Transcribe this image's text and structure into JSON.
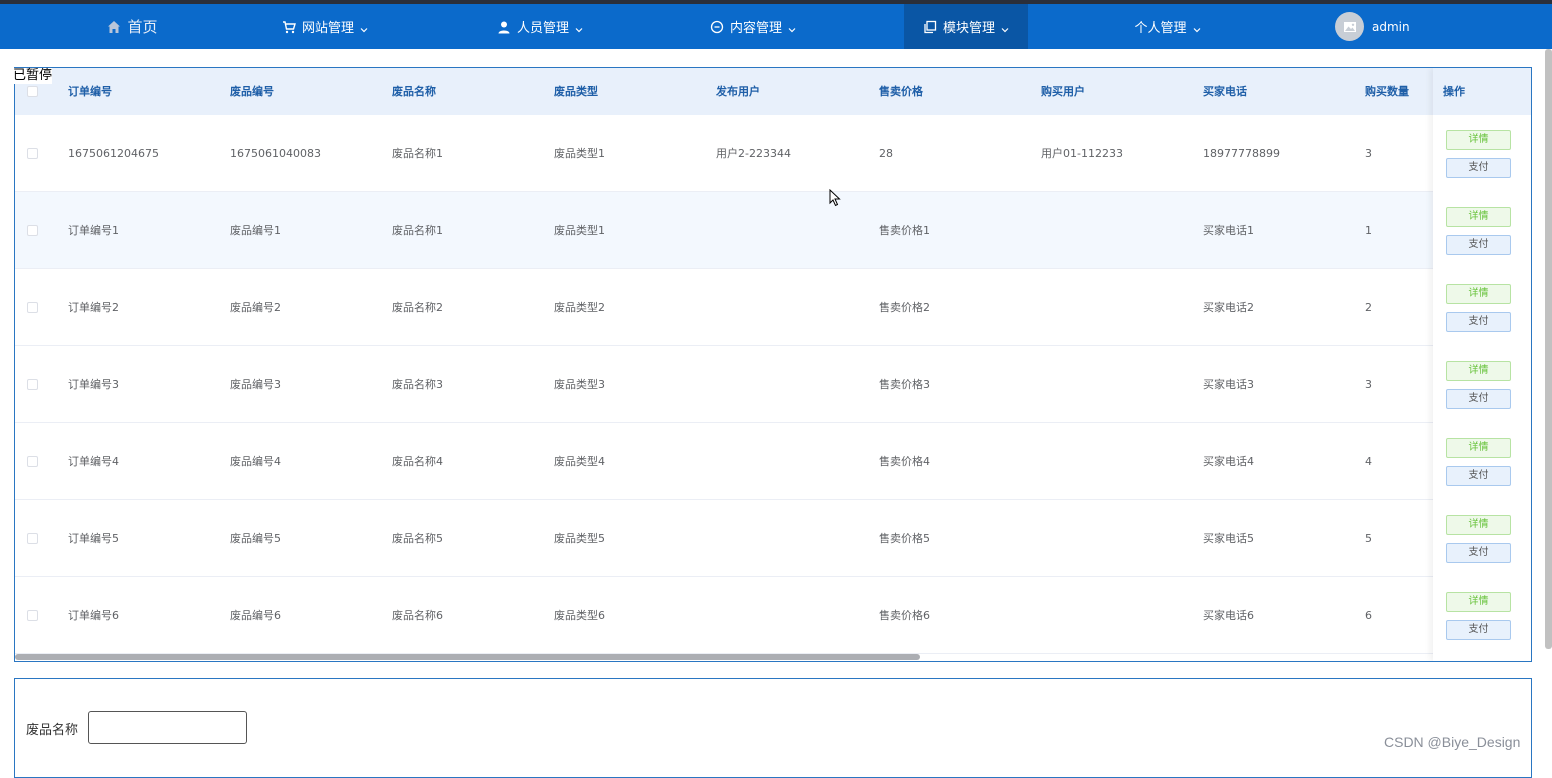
{
  "nav": {
    "home": "首页",
    "site_manage": "网站管理",
    "people_manage": "人员管理",
    "content_manage": "内容管理",
    "module_manage": "模块管理",
    "personal_manage": "个人管理",
    "user": "admin"
  },
  "overlay": {
    "paused": "已暂停"
  },
  "table": {
    "headers": {
      "order_no": "订单编号",
      "item_no": "废品编号",
      "item_name": "废品名称",
      "item_type": "废品类型",
      "publisher": "发布用户",
      "price": "售卖价格",
      "buyer": "购买用户",
      "buyer_phone": "买家电话",
      "quantity": "购买数量",
      "actions": "操作"
    },
    "rows": [
      {
        "order_no": "1675061204675",
        "item_no": "1675061040083",
        "item_name": "废品名称1",
        "item_type": "废品类型1",
        "publisher": "用户2-223344",
        "price": "28",
        "buyer": "用户01-112233",
        "buyer_phone": "18977778899",
        "quantity": "3"
      },
      {
        "order_no": "订单编号1",
        "item_no": "废品编号1",
        "item_name": "废品名称1",
        "item_type": "废品类型1",
        "publisher": "",
        "price": "售卖价格1",
        "buyer": "",
        "buyer_phone": "买家电话1",
        "quantity": "1"
      },
      {
        "order_no": "订单编号2",
        "item_no": "废品编号2",
        "item_name": "废品名称2",
        "item_type": "废品类型2",
        "publisher": "",
        "price": "售卖价格2",
        "buyer": "",
        "buyer_phone": "买家电话2",
        "quantity": "2"
      },
      {
        "order_no": "订单编号3",
        "item_no": "废品编号3",
        "item_name": "废品名称3",
        "item_type": "废品类型3",
        "publisher": "",
        "price": "售卖价格3",
        "buyer": "",
        "buyer_phone": "买家电话3",
        "quantity": "3"
      },
      {
        "order_no": "订单编号4",
        "item_no": "废品编号4",
        "item_name": "废品名称4",
        "item_type": "废品类型4",
        "publisher": "",
        "price": "售卖价格4",
        "buyer": "",
        "buyer_phone": "买家电话4",
        "quantity": "4"
      },
      {
        "order_no": "订单编号5",
        "item_no": "废品编号5",
        "item_name": "废品名称5",
        "item_type": "废品类型5",
        "publisher": "",
        "price": "售卖价格5",
        "buyer": "",
        "buyer_phone": "买家电话5",
        "quantity": "5"
      },
      {
        "order_no": "订单编号6",
        "item_no": "废品编号6",
        "item_name": "废品名称6",
        "item_type": "废品类型6",
        "publisher": "",
        "price": "售卖价格6",
        "buyer": "",
        "buyer_phone": "买家电话6",
        "quantity": "6"
      }
    ],
    "detail_label": "详情",
    "pay_label": "支付"
  },
  "search": {
    "name_label": "废品名称",
    "name_value": "",
    "name_placeholder": ""
  },
  "watermark": "CSDN @Biye_Design",
  "colors": {
    "nav_bg": "#0b6acb",
    "nav_active": "#0a56a5",
    "header_text": "#1f5fa8",
    "detail_green": "#67c23a"
  }
}
